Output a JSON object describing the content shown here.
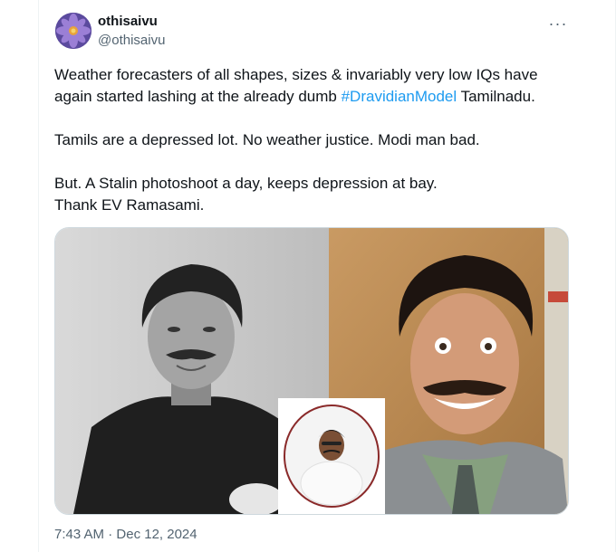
{
  "author": {
    "display_name": "othisaivu",
    "handle": "@othisaivu"
  },
  "more_label": "···",
  "tweet": {
    "line1_pre": "Weather forecasters of all shapes, sizes & invariably very low IQs have again started lashing at the already dumb ",
    "hashtag": "#DravidianModel",
    "line1_post": " Tamilnadu.",
    "para2": "Tamils are a depressed lot. No weather justice. Modi man bad.",
    "para3_line1": "But. A Stalin photoshoot a day, keeps depression at bay.",
    "para3_line2": "Thank EV Ramasami."
  },
  "timestamp": {
    "time": "7:43 AM",
    "separator": " · ",
    "date": "Dec 12, 2024"
  },
  "colors": {
    "link": "#1d9bf0",
    "secondary_text": "#536471",
    "border": "#cfd9de"
  }
}
